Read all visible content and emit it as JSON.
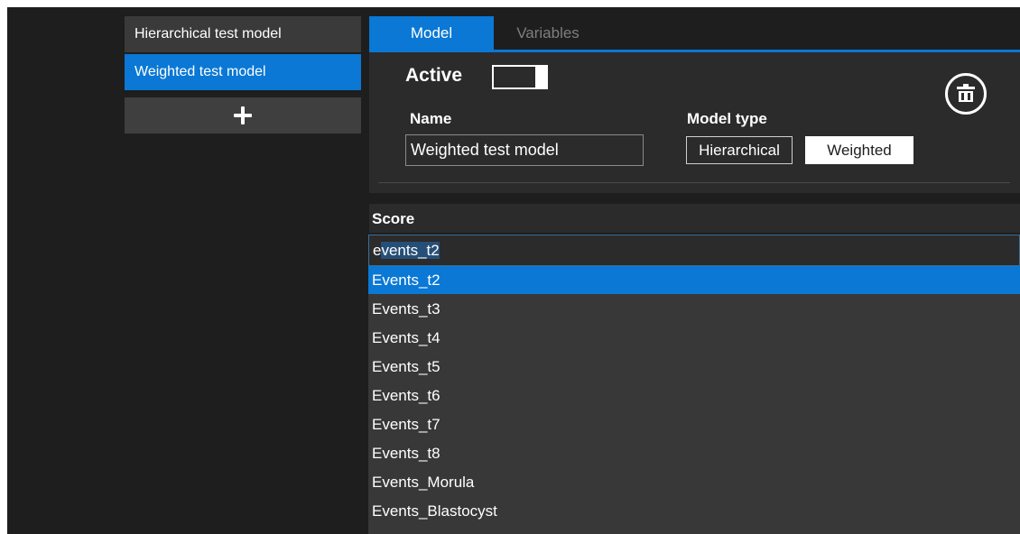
{
  "models": [
    {
      "label": "Hierarchical test model",
      "selected": false
    },
    {
      "label": "Weighted test model",
      "selected": true
    }
  ],
  "add_button": {
    "icon": "plus-icon"
  },
  "tabs": [
    {
      "label": "Model",
      "active": true
    },
    {
      "label": "Variables",
      "active": false
    }
  ],
  "model": {
    "active_label": "Active",
    "active": true,
    "delete_icon": "trash-icon",
    "name_label": "Name",
    "name_value": "Weighted test model",
    "type_label": "Model type",
    "type_options": [
      "Hierarchical",
      "Weighted"
    ],
    "type_selected": "Weighted"
  },
  "score": {
    "label": "Score",
    "typed": "e",
    "autocompleted": "vents_t2",
    "options": [
      "Events_t2",
      "Events_t3",
      "Events_t4",
      "Events_t5",
      "Events_t6",
      "Events_t7",
      "Events_t8",
      "Events_Morula",
      "Events_Blastocyst"
    ],
    "highlighted": "Events_t2"
  },
  "colors": {
    "accent": "#0a78d4",
    "background": "#1e1e1e",
    "panel": "#2b2b2b",
    "dropdown": "#383838"
  }
}
